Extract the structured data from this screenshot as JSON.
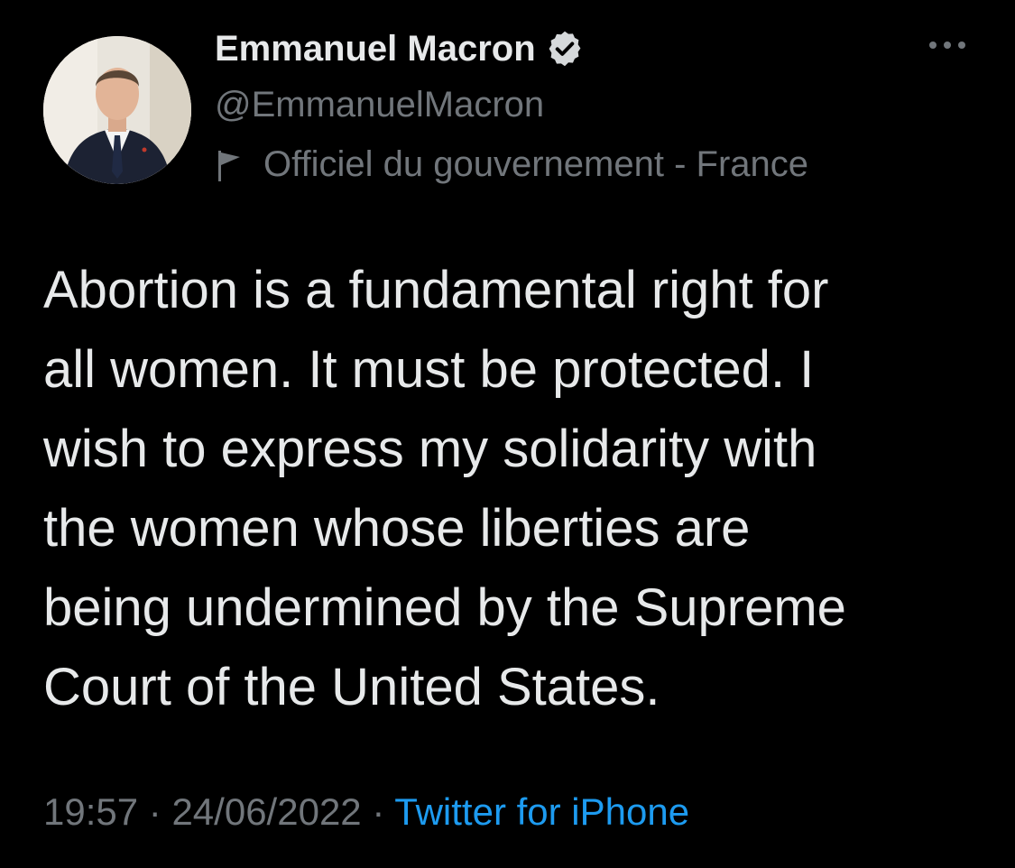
{
  "author": {
    "name": "Emmanuel Macron",
    "handle": "@EmmanuelMacron",
    "label": "Officiel du gouvernement - France",
    "verified": true
  },
  "tweet": {
    "text": "Abortion is a fundamental right for\nall women. It must be protected. I\nwish to express my solidarity with\nthe women whose liberties are\nbeing undermined by the Supreme\nCourt of the United States."
  },
  "meta": {
    "time": "19:57",
    "separator": "·",
    "date": "24/06/2022",
    "source": "Twitter for iPhone"
  },
  "icons": {
    "verified": "verified-badge-icon",
    "label": "flag-icon",
    "more": "more-horizontal-icon"
  },
  "colors": {
    "background": "#000000",
    "primary_text": "#e7e9ea",
    "secondary_text": "#71767b",
    "link": "#1d9bf0"
  }
}
